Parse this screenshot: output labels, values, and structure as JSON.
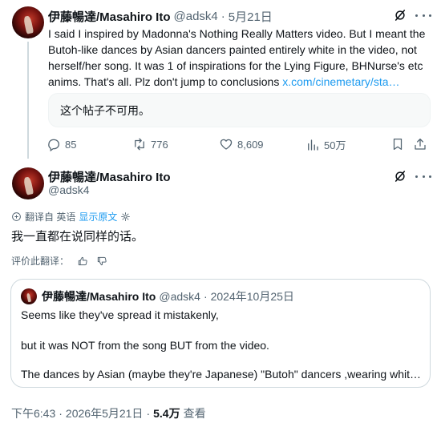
{
  "tweet1": {
    "display_name": "伊藤暢達/Masahiro Ito",
    "handle": "@adsk4",
    "separator": "·",
    "date": "5月21日",
    "text_lines": [
      "I said I inspired by Madonna's Nothing Really Matters video. But I meant the",
      "Butoh-like dances by Asian dancers painted entirely white in the video, not",
      "herself/her song. It was 1 of inspirations for the Lying Figure, BHNurse's etc",
      "anims. That's all. Plz don't jump to conclusions "
    ],
    "link_text": "x.com/cinemetary/sta…",
    "unavailable_text": "这个帖子不可用。",
    "metrics": {
      "replies": "85",
      "reposts": "776",
      "likes": "8,609",
      "views": "50万"
    }
  },
  "tweet2": {
    "display_name": "伊藤暢達/Masahiro Ito",
    "handle": "@adsk4",
    "translated_from": "翻译自 英语",
    "show_original": "显示原文",
    "text": "我一直都在说同样的话。",
    "rate_translation": "评价此翻译：",
    "quote": {
      "display_name": "伊藤暢達/Masahiro Ito",
      "handle": "@adsk4",
      "separator": "·",
      "date": "2024年10月25日",
      "line1": "Seems like they've spread it mistakenly,",
      "line2": "but it was NOT from the song BUT from the video.",
      "line3": "The dances by Asian (maybe they're Japanese) \"Butoh\" dancers ,wearing whit…"
    },
    "footer": {
      "time": "下午6:43",
      "sep1": "·",
      "date": "2026年5月21日",
      "sep2": "·",
      "views_count": "5.4万",
      "views_label": "查看"
    }
  },
  "colors": {
    "text": "#0f1419",
    "secondary": "#536471",
    "link": "#1d9bf0",
    "border": "#cfd9de"
  }
}
